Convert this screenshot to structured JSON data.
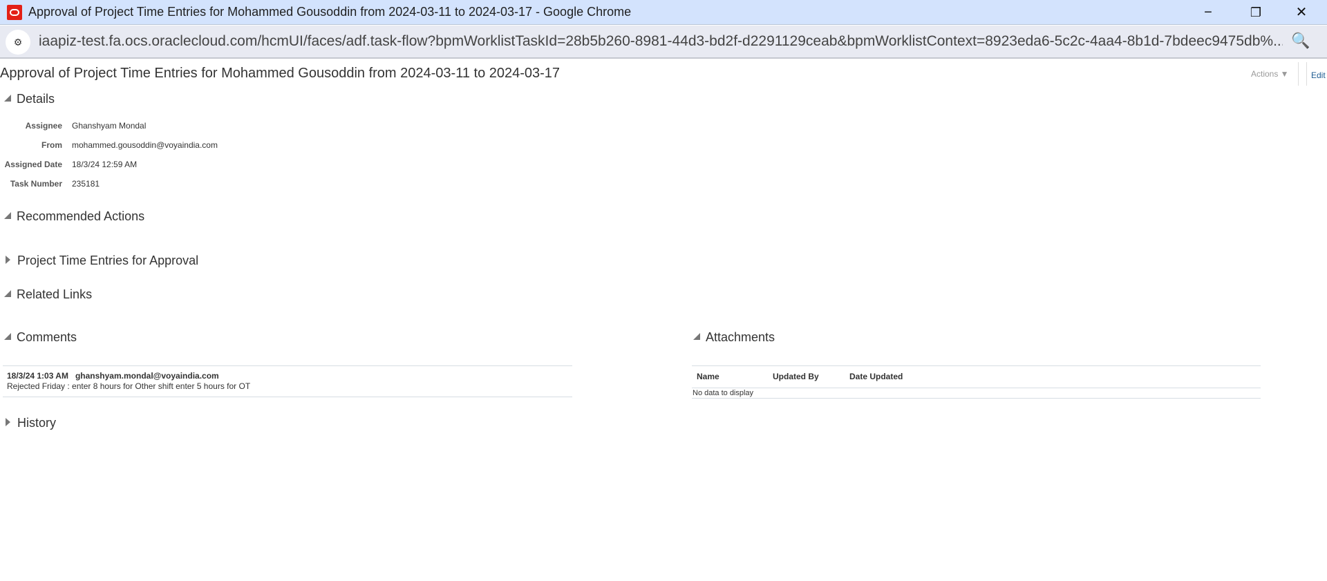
{
  "browser": {
    "window_title": "Approval of Project Time Entries for Mohammed Gousoddin from 2024-03-11 to 2024-03-17 - Google Chrome",
    "url": "iaapiz-test.fa.ocs.oraclecloud.com/hcmUI/faces/adf.task-flow?bpmWorklistTaskId=28b5b260-8981-44d3-bd2f-d2291129ceab&bpmWorklistContext=8923eda6-5c2c-4aa4-8b1d-7bdeec9475db%...",
    "minimize": "−",
    "restore": "❐",
    "close": "✕",
    "site_info": "⚙",
    "zoom": "🔍"
  },
  "page": {
    "title": "Approval of Project Time Entries for Mohammed Gousoddin from 2024-03-11 to 2024-03-17",
    "actions_label": "Actions ▼",
    "edit_label": "Edit"
  },
  "details": {
    "header": "Details",
    "fields": [
      {
        "label": "Assignee",
        "value": "Ghanshyam Mondal"
      },
      {
        "label": "From",
        "value": "mohammed.gousoddin@voyaindia.com"
      },
      {
        "label": "Assigned Date",
        "value": "18/3/24 12:59 AM"
      },
      {
        "label": "Task Number",
        "value": "235181"
      }
    ]
  },
  "sections": {
    "recommended": "Recommended Actions",
    "time_entries": "Project Time Entries for Approval",
    "related": "Related Links",
    "comments": "Comments",
    "attachments": "Attachments",
    "history": "History"
  },
  "comments": [
    {
      "date": "18/3/24 1:03 AM",
      "author": "ghanshyam.mondal@voyaindia.com",
      "text": "Rejected Friday : enter 8 hours for Other shift enter 5 hours for OT"
    }
  ],
  "attachments": {
    "columns": [
      "Name",
      "Updated By",
      "Date Updated"
    ],
    "empty": "No data to display"
  }
}
